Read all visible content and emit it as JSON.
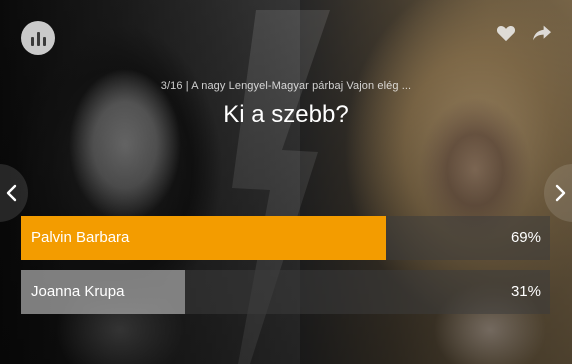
{
  "header": {
    "subtitle": "3/16 | A nagy Lengyel-Magyar párbaj Vajon elég ...",
    "question": "Ki a szebb?",
    "icons": {
      "logo": "poll-logo-icon",
      "like": "heart-icon",
      "share": "share-arrow-icon"
    }
  },
  "navigation": {
    "prev": "chevron-left-icon",
    "next": "chevron-right-icon"
  },
  "answers": [
    {
      "label": "Palvin Barbara",
      "percent_label": "69%",
      "percent": 69,
      "color": "#f39c00"
    },
    {
      "label": "Joanna Krupa",
      "percent_label": "31%",
      "percent": 31,
      "color": "#c9c9c9"
    }
  ],
  "colors": {
    "accent": "#f39c00",
    "secondary_bar": "#c9c9c9"
  }
}
